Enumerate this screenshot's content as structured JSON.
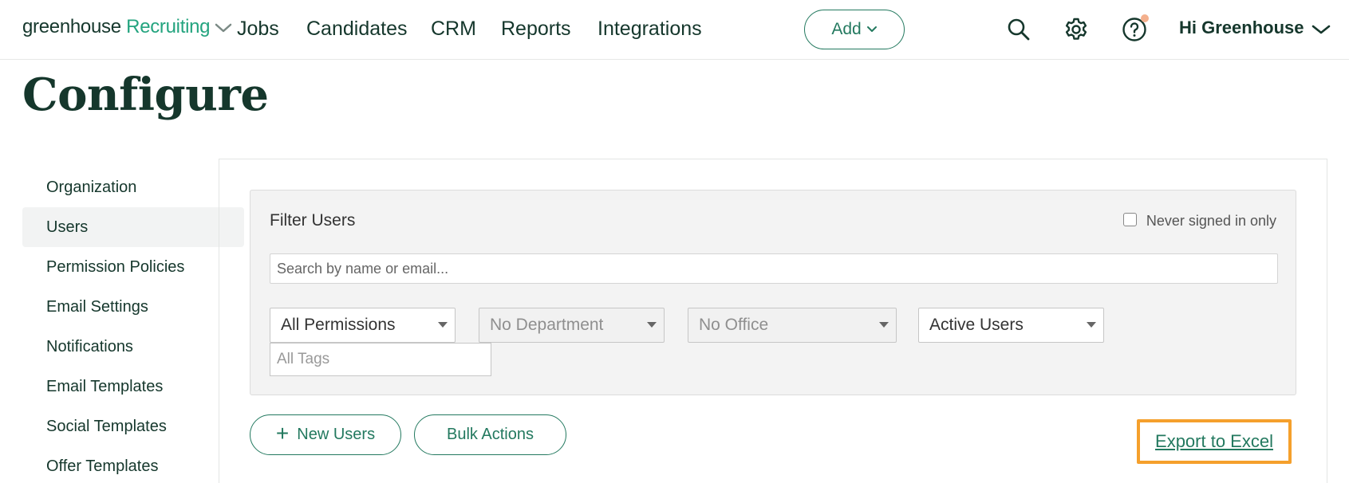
{
  "brand": {
    "name_part1": "greenhouse",
    "name_part2": "Recruiting"
  },
  "nav": {
    "links": [
      "Jobs",
      "Candidates",
      "CRM",
      "Reports",
      "Integrations"
    ],
    "add_label": "Add",
    "user_greeting": "Hi Greenhouse"
  },
  "icons": [
    "search-icon",
    "gear-icon",
    "help-icon",
    "chevron-down-icon",
    "plus-icon"
  ],
  "page": {
    "title": "Configure"
  },
  "sidebar": {
    "items": [
      {
        "label": "Organization"
      },
      {
        "label": "Users",
        "active": true
      },
      {
        "label": "Permission Policies"
      },
      {
        "label": "Email Settings"
      },
      {
        "label": "Notifications"
      },
      {
        "label": "Email Templates"
      },
      {
        "label": "Social Templates"
      },
      {
        "label": "Offer Templates"
      }
    ]
  },
  "filter": {
    "title": "Filter Users",
    "never_signed_label": "Never signed in only",
    "never_signed_checked": false,
    "search_placeholder": "Search by name or email...",
    "permissions": "All Permissions",
    "department": "No Department",
    "office": "No Office",
    "status": "Active Users",
    "tags_placeholder": "All Tags"
  },
  "actions": {
    "new_users": "New Users",
    "bulk_actions": "Bulk Actions",
    "export": "Export to Excel"
  },
  "colors": {
    "brand_green": "#24a47f",
    "button_green": "#23795f",
    "text_dark": "#15372c",
    "highlight_orange": "#f5a02c",
    "notification_dot": "#f4b08d"
  }
}
